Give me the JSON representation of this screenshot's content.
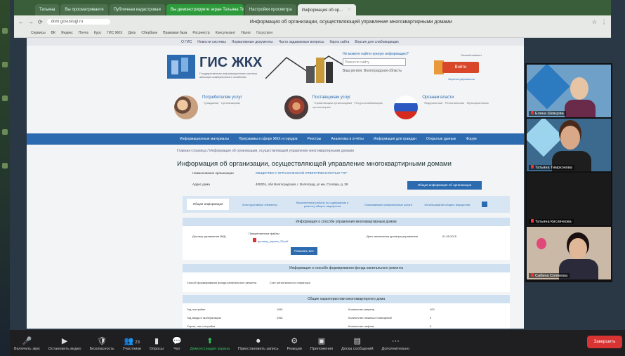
{
  "browser": {
    "tabs": [
      {
        "label": "Татьяна",
        "state": "normal"
      },
      {
        "label": "Вы просматриваете",
        "state": "normal"
      },
      {
        "label": "Публичная кадастровая",
        "state": "normal"
      },
      {
        "label": "Вы демонстрируете экран Татьяна Тимрхонова",
        "state": "green"
      },
      {
        "label": "Настройки просмотра",
        "state": "normal"
      },
      {
        "label": "Информация об ор...",
        "state": "active"
      }
    ],
    "address": "dom.gosuslugi.ru",
    "page_heading": "Информация об организации, осуществляющей управление многоквартирными домами",
    "bookmarks": [
      "Сервисы",
      "ВК",
      "Яндекс",
      "Почта",
      "Курс",
      "ГИС ЖКХ",
      "Диск",
      "Сбербанк",
      "Правовая база",
      "Росреестр",
      "Консультант",
      "Налог",
      "Госуслуги"
    ]
  },
  "site": {
    "logo_text": "ГИС ЖКХ",
    "logo_sub": "Государственная информационная система жилищно-коммунального хозяйства",
    "top_links": [
      "О ГИС",
      "Новости системы",
      "Нормативные документы",
      "Часто задаваемые вопросы",
      "Карта сайта",
      "Версия для слабовидящих"
    ],
    "search_label": "Не можете найти нужную информацию?",
    "search_placeholder": "Поиск по сайту",
    "region": "Ваш регион: Волгоградская область",
    "contrast": "Личный кабинет",
    "login_label": "Войти",
    "register_link": "Зарегистрироваться",
    "audiences": [
      {
        "title": "Потребителям услуг",
        "sub": "· Гражданам · Организациям"
      },
      {
        "title": "Поставщикам услуг",
        "sub": "· Управляющим организациям · Ресурсоснабжающим организациям"
      },
      {
        "title": "Органам власти",
        "sub": "· Федеральным · Региональным · Муниципальным"
      }
    ],
    "nav": [
      "Информационные материалы",
      "Программы в сфере ЖКХ и городов",
      "Реестры",
      "Аналитика и отчёты",
      "Информация для граждан",
      "Открытые данные",
      "Форум"
    ],
    "breadcrumbs": "Главная страница  /  Информация об организации, осуществляющей управление многоквартирными домами",
    "title": "Информация об организации, осуществляющей управление многоквартирными домами",
    "org_label": "Наименование организации",
    "org_value": "ОБЩЕСТВО С ОГРАНИЧЕННОЙ ОТВЕТСТВЕННОСТЬЮ \"УК\"",
    "address_label": "Адрес дома",
    "address_value": "400001, обл Волгоградская, г. Волгоград, ул им. Столяра, д. 28",
    "general_button": "Общая информация об организации",
    "subtabs": [
      "Общая информация",
      "Конструктивные элементы",
      "Выполненные работы по содержанию и ремонту общего имущества",
      "Оказываемые коммунальные услуги",
      "Использование общего имущества"
    ],
    "section1": "Информация о способе управления многоквартирным домом",
    "s1_row_label": "Договор управления МКД",
    "s1_docs_label": "Прикрепленные файлы",
    "s1_file": "договор_управл_28.pdf",
    "s1_date_label": "Дата заключения договора управления",
    "s1_date_value": "01.05.2015",
    "show_all": "Показать все",
    "section2": "Информация о способе формирования фонда капитального ремонта",
    "s2_row_label": "Способ формирования фонда капитального ремонта",
    "s2_row_value": "Счет регионального оператора",
    "section3": "Общие характеристики многоквартирного дома",
    "s3_rows": [
      {
        "k": "Год постройки",
        "v": "1961",
        "k2": "Количество квартир",
        "v2": "100"
      },
      {
        "k": "Год ввода в эксплуатацию",
        "v": "1961",
        "k2": "Количество нежилых помещений",
        "v2": "0"
      },
      {
        "k": "Серия, тип постройки",
        "v": "",
        "k2": "Количество лифтов",
        "v2": "0"
      }
    ]
  },
  "participants": [
    {
      "name": "Елена Шевцова",
      "bg": "#6fa0c8"
    },
    {
      "name": "Татьяна Тимрхонова",
      "bg": "#3b6a8e"
    },
    {
      "name": "Татьяна Кисличкова",
      "bg": "#1a1a1a"
    },
    {
      "name": "Сабина Солянова",
      "bg": "#c9b9a6"
    }
  ],
  "toolbar": {
    "items": [
      {
        "icon": "🎤",
        "label": "Включить звук",
        "name": "unmute"
      },
      {
        "icon": "▶",
        "label": "Остановить видео",
        "name": "stop-video"
      },
      {
        "icon": "🛡",
        "label": "Безопасность",
        "name": "security"
      },
      {
        "icon": "👥",
        "label": "Участники",
        "name": "participants"
      },
      {
        "icon": "▮",
        "label": "Опросы",
        "name": "polls"
      },
      {
        "icon": "💬",
        "label": "Чат",
        "name": "chat"
      },
      {
        "icon": "⬆",
        "label": "Демонстрация экрана",
        "name": "share-screen"
      },
      {
        "icon": "⏺",
        "label": "Приостановить запись",
        "name": "pause-record"
      },
      {
        "icon": "⚙",
        "label": "Реакции",
        "name": "reactions"
      },
      {
        "icon": "▣",
        "label": "Приложения",
        "name": "apps"
      },
      {
        "icon": "▤",
        "label": "Доска сообщений",
        "name": "whiteboard"
      },
      {
        "icon": "⋯",
        "label": "Дополнительно",
        "name": "more"
      }
    ],
    "participants_count": "23",
    "end_label": "Завершить"
  }
}
